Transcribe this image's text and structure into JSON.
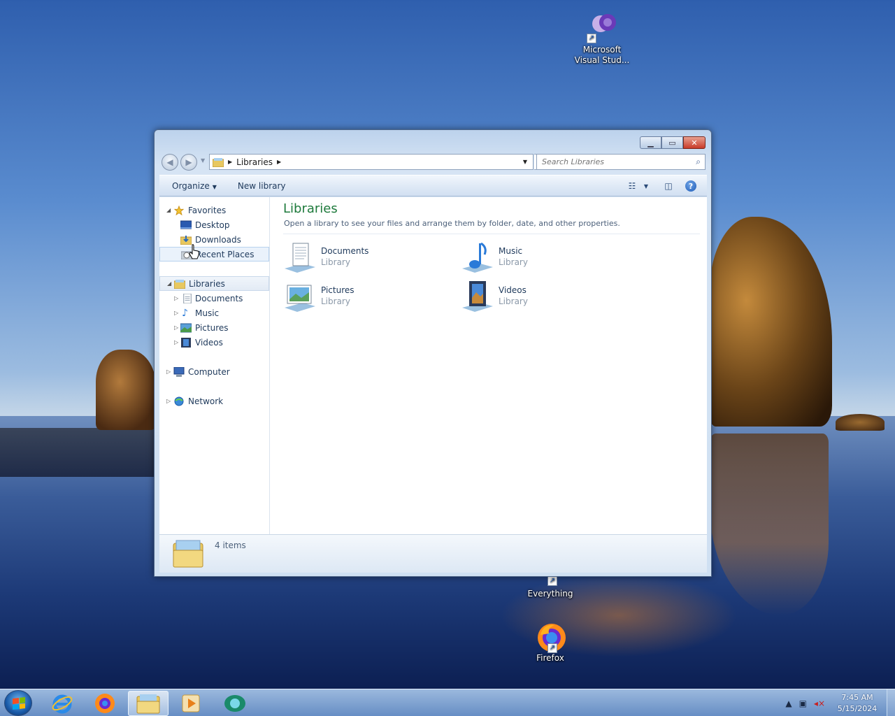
{
  "desktop": {
    "icons": [
      {
        "label": "Microsoft Visual Stud...",
        "icon": "visual-studio-icon"
      },
      {
        "label": "Everything",
        "icon": "everything-icon"
      },
      {
        "label": "Firefox",
        "icon": "firefox-icon"
      }
    ]
  },
  "window": {
    "address": {
      "crumb": "Libraries"
    },
    "search": {
      "placeholder": "Search Libraries"
    },
    "toolbar": {
      "organize": "Organize",
      "new_library": "New library"
    },
    "nav": {
      "favorites": "Favorites",
      "desktop": "Desktop",
      "downloads": "Downloads",
      "recent": "Recent Places",
      "libraries": "Libraries",
      "documents": "Documents",
      "music": "Music",
      "pictures": "Pictures",
      "videos": "Videos",
      "computer": "Computer",
      "network": "Network"
    },
    "main": {
      "title": "Libraries",
      "subtitle": "Open a library to see your files and arrange them by folder, date, and other properties.",
      "libraries": [
        {
          "name": "Documents",
          "kind": "Library",
          "icon": "documents-library-icon"
        },
        {
          "name": "Music",
          "kind": "Library",
          "icon": "music-library-icon"
        },
        {
          "name": "Pictures",
          "kind": "Library",
          "icon": "pictures-library-icon"
        },
        {
          "name": "Videos",
          "kind": "Library",
          "icon": "videos-library-icon"
        }
      ]
    },
    "details": {
      "count": "4 items"
    }
  },
  "taskbar": {
    "apps": [
      "internet-explorer-icon",
      "firefox-icon",
      "windows-explorer-icon",
      "media-player-icon",
      "app-icon"
    ],
    "active": "windows-explorer-icon",
    "clock": {
      "time": "7:45 AM",
      "date": "5/15/2024"
    }
  }
}
